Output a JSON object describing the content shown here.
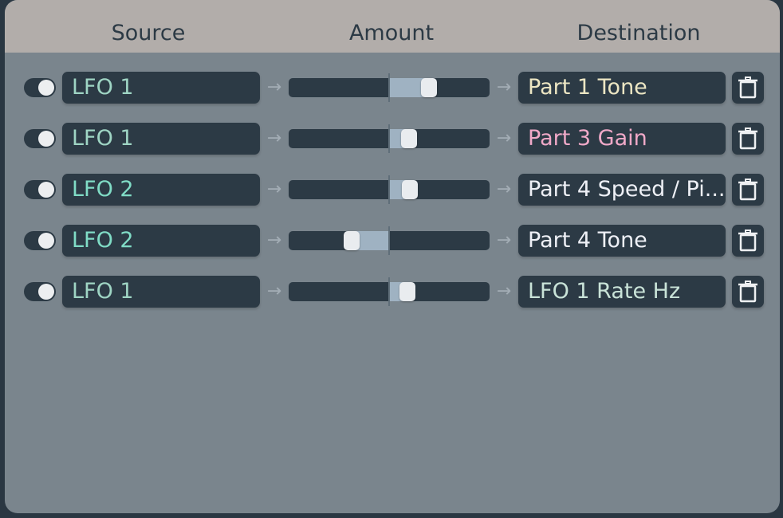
{
  "header": {
    "source_label": "Source",
    "amount_label": "Amount",
    "destination_label": "Destination"
  },
  "colors": {
    "source_lfo1": "#9fd5c4",
    "source_lfo2": "#80dcc6",
    "dest_part1_tone": "#ece6c3",
    "dest_part3_gain": "#f0a9c8",
    "dest_part4": "#eef0f6",
    "dest_lfo1_rate": "#c9e3d8"
  },
  "rows": [
    {
      "enabled": true,
      "source": "LFO 1",
      "amount": 0.4,
      "destination": "Part 1 Tone",
      "source_color": "#9fd5c4",
      "dest_color": "#ece6c3",
      "icon": "trash-icon"
    },
    {
      "enabled": true,
      "source": "LFO 1",
      "amount": 0.2,
      "destination": "Part 3 Gain",
      "source_color": "#9fd5c4",
      "dest_color": "#f0a9c8",
      "icon": "trash-icon"
    },
    {
      "enabled": true,
      "source": "LFO 2",
      "amount": 0.21,
      "destination": "Part 4 Speed / Pi...",
      "source_color": "#80dcc6",
      "dest_color": "#eef0f6",
      "icon": "trash-icon"
    },
    {
      "enabled": true,
      "source": "LFO 2",
      "amount": -0.37,
      "destination": "Part 4 Tone",
      "source_color": "#80dcc6",
      "dest_color": "#eef0f6",
      "icon": "trash-icon"
    },
    {
      "enabled": true,
      "source": "LFO 1",
      "amount": 0.18,
      "destination": "LFO 1 Rate Hz",
      "source_color": "#9fd5c4",
      "dest_color": "#c9e3d8",
      "icon": "trash-icon"
    }
  ]
}
